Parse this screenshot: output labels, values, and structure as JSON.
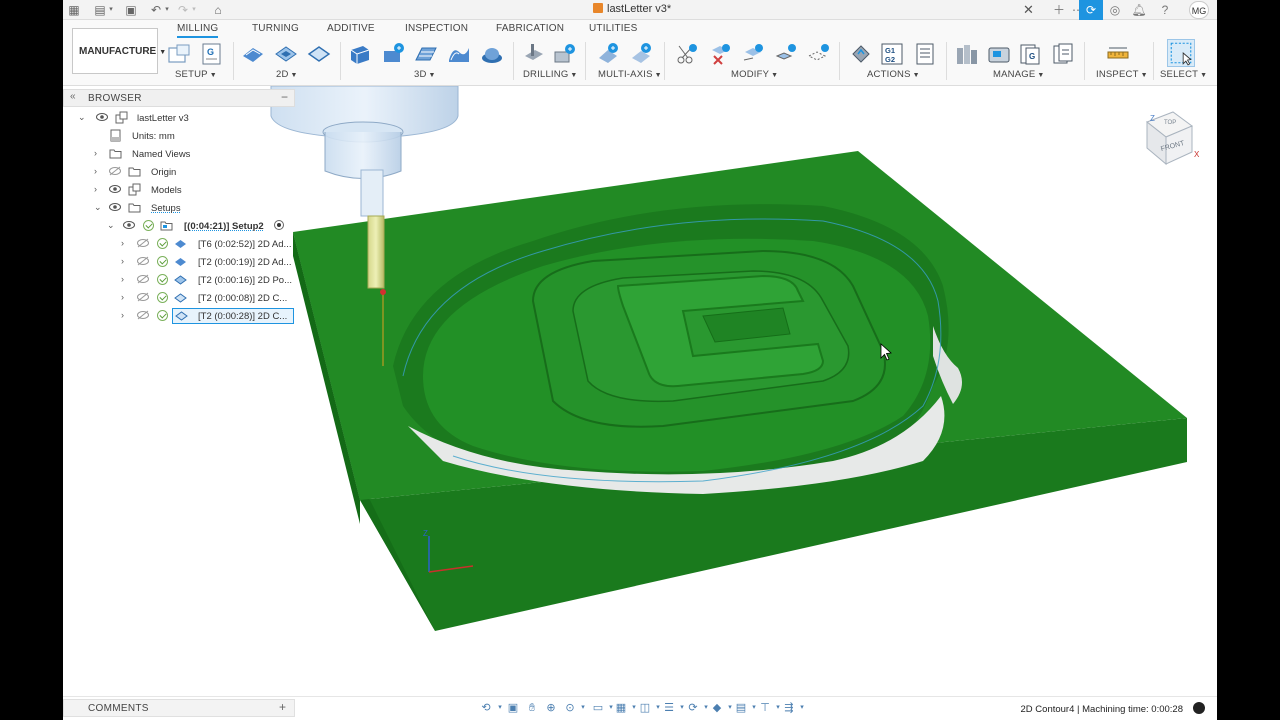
{
  "app": {
    "document_title": "lastLetter v3*"
  },
  "user": {
    "initials": "MG"
  },
  "ribbon": {
    "workspace": "MANUFACTURE",
    "tabs": [
      {
        "label": "MILLING",
        "active": true
      },
      {
        "label": "TURNING"
      },
      {
        "label": "ADDITIVE"
      },
      {
        "label": "INSPECTION"
      },
      {
        "label": "FABRICATION"
      },
      {
        "label": "UTILITIES"
      }
    ],
    "groups": {
      "setup": "SETUP",
      "two_d": "2D",
      "three_d": "3D",
      "drilling": "DRILLING",
      "multi_axis": "MULTI-AXIS",
      "modify": "MODIFY",
      "actions": "ACTIONS",
      "manage": "MANAGE",
      "inspect": "INSPECT",
      "select": "SELECT"
    },
    "g1g2_label": "G1\nG2",
    "g_label": "G"
  },
  "browser": {
    "title": "BROWSER",
    "items": [
      {
        "label": "lastLetter v3"
      },
      {
        "label": "Units: mm"
      },
      {
        "label": "Named Views"
      },
      {
        "label": "Origin"
      },
      {
        "label": "Models"
      },
      {
        "label": "Setups"
      },
      {
        "label": "[(0:04:21)] Setup2"
      },
      {
        "label": "[T6 (0:02:52)] 2D Ad..."
      },
      {
        "label": "[T2 (0:00:19)] 2D Ad..."
      },
      {
        "label": "[T2 (0:00:16)] 2D Po..."
      },
      {
        "label": "[T2 (0:00:08)] 2D C..."
      },
      {
        "label": "[T2 (0:00:28)] 2D C..."
      }
    ]
  },
  "viewcube": {
    "top": "TOP",
    "front": "FRONT",
    "axis_x": "X",
    "axis_z": "Z"
  },
  "triad": {
    "z": "Z"
  },
  "comments": {
    "title": "COMMENTS"
  },
  "status": {
    "text": "2D Contour4 | Machining time: 0:00:28"
  },
  "colors": {
    "stock_top": "#228a24",
    "stock_front": "#1a7a1d",
    "stock_side": "#136a16",
    "accent": "#1e94e0"
  }
}
